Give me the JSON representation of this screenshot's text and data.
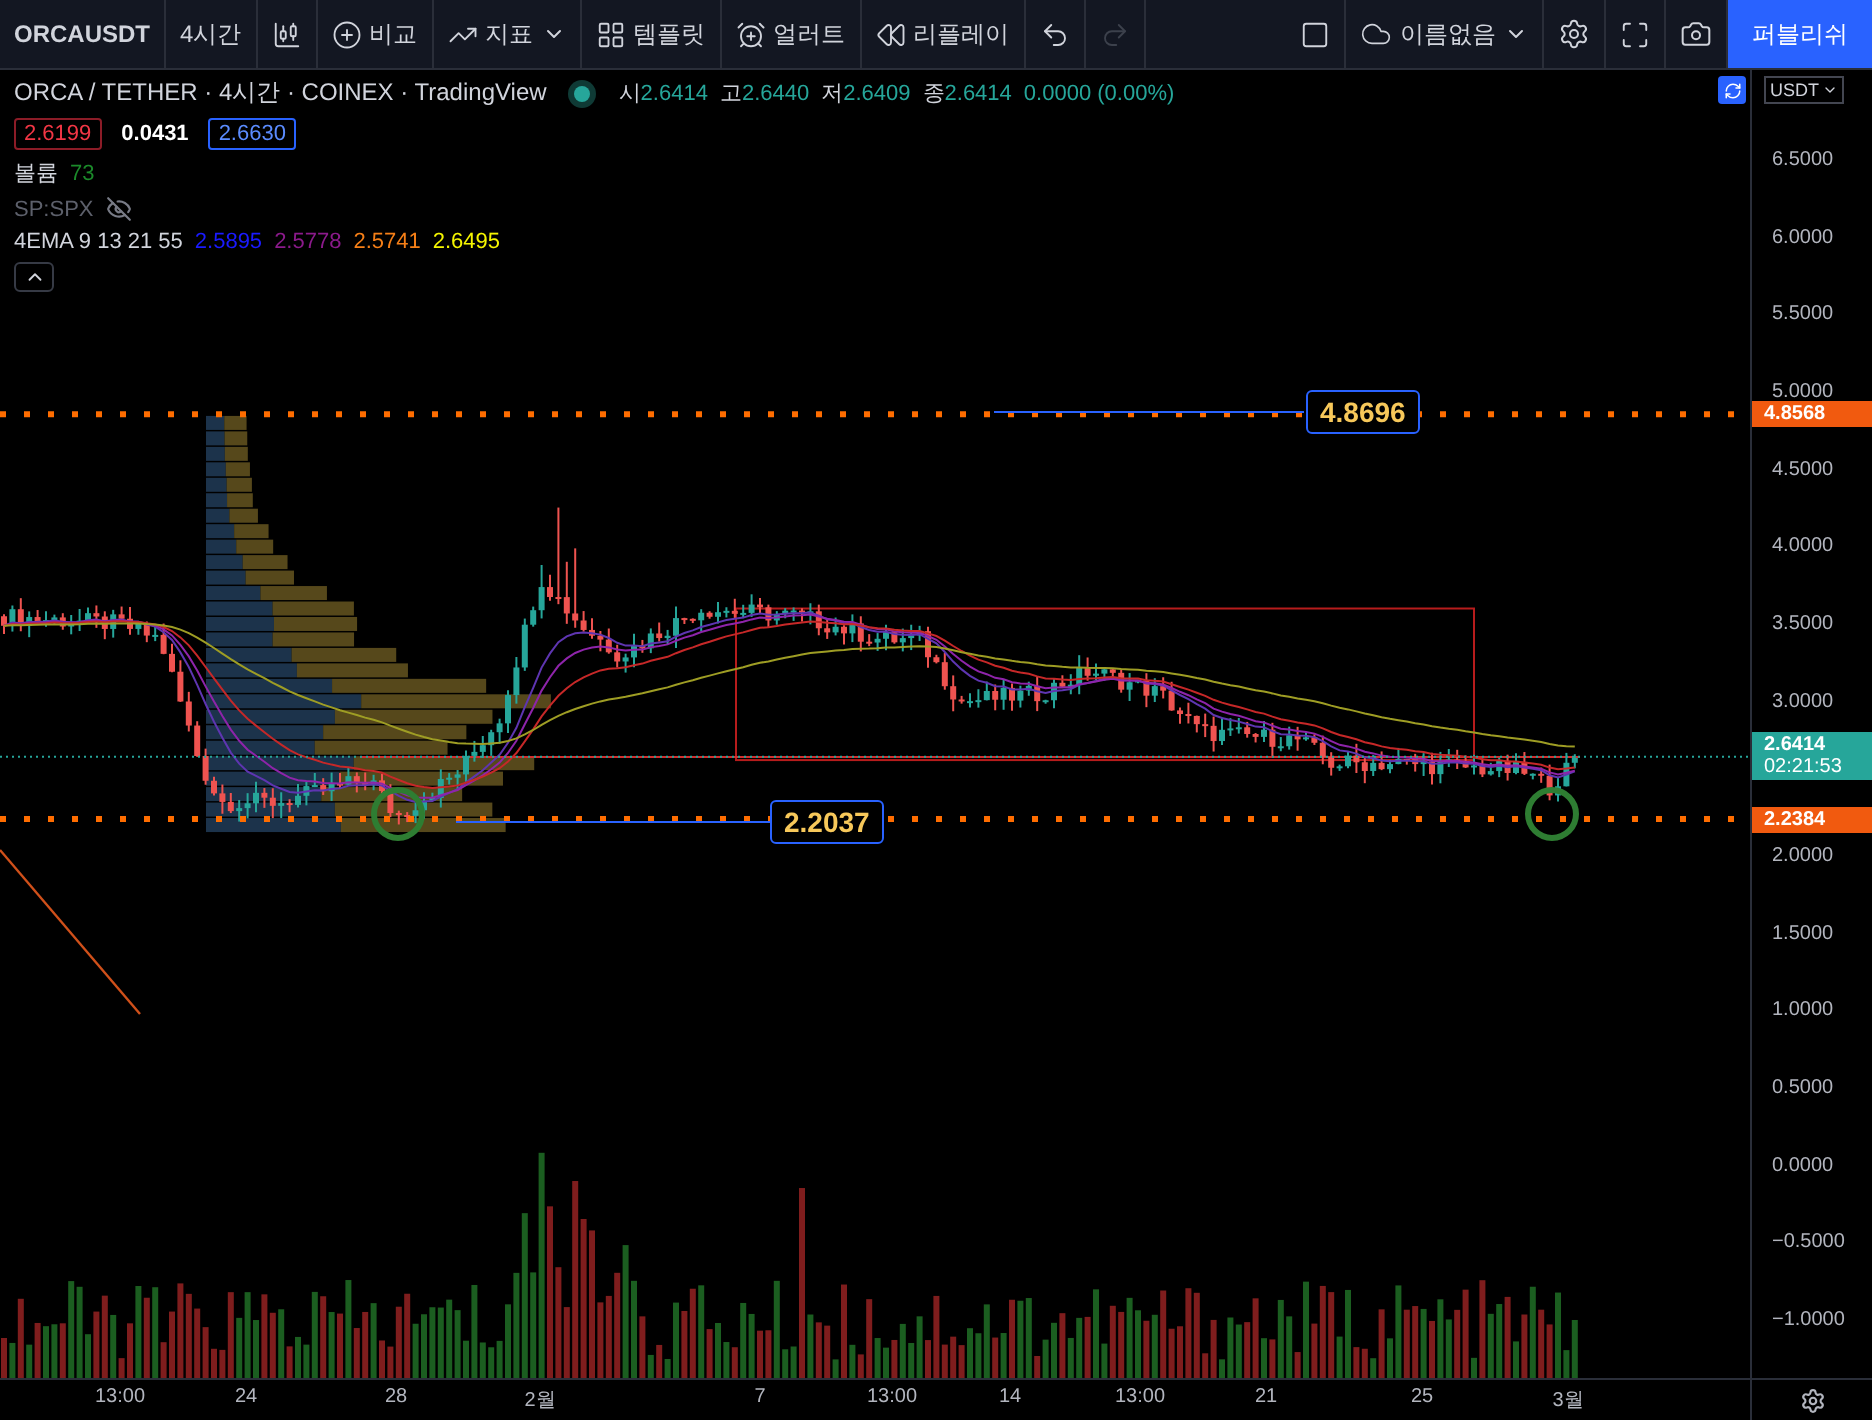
{
  "toolbar": {
    "symbol": "ORCAUSDT",
    "interval": "4시간",
    "items": [
      {
        "kind": "chart-type"
      },
      {
        "kind": "compare",
        "label": "비교"
      },
      {
        "kind": "indicators",
        "label": "지표"
      },
      {
        "kind": "templates",
        "label": "템플릿"
      },
      {
        "kind": "alert",
        "label": "얼러트"
      },
      {
        "kind": "replay",
        "label": "리플레이"
      },
      {
        "kind": "undo",
        "disabled": false
      },
      {
        "kind": "redo",
        "disabled": true
      }
    ],
    "layout_name": "이름없음",
    "publish": "퍼블리쉬"
  },
  "legend": {
    "title": "ORCA / TETHER · 4시간 · COINEX · TradingView",
    "ohlc": [
      {
        "label": "시",
        "value": "2.6414"
      },
      {
        "label": "고",
        "value": "2.6440"
      },
      {
        "label": "저",
        "value": "2.6409"
      },
      {
        "label": "종",
        "value": "2.6414"
      }
    ],
    "change": "0.0000 (0.00%)",
    "quotes": [
      {
        "kind": "bid",
        "value": "2.6199"
      },
      {
        "kind": "spread",
        "value": "0.0431"
      },
      {
        "kind": "ask",
        "value": "2.6630"
      }
    ],
    "volume": {
      "name": "볼륨",
      "value": "73"
    },
    "overlay": {
      "name": "SP:SPX",
      "hidden": true
    },
    "ema": {
      "name": "4EMA 9 13 21 55",
      "values": [
        {
          "value": "2.5895",
          "color": "#1a1aff"
        },
        {
          "value": "2.5778",
          "color": "#8b1a8b"
        },
        {
          "value": "2.5741",
          "color": "#f57f17"
        },
        {
          "value": "2.6495",
          "color": "#f5f500"
        }
      ]
    }
  },
  "annotations": [
    {
      "value": "4.8696"
    },
    {
      "value": "2.2037"
    }
  ],
  "price_axis": {
    "currency": "USDT",
    "ticks": [
      "6.5000",
      "6.0000",
      "5.5000",
      "5.0000",
      "4.5000",
      "4.0000",
      "3.5000",
      "3.0000",
      "2.0000",
      "1.5000",
      "1.0000",
      "0.5000",
      "0.0000",
      "−0.5000",
      "−1.0000"
    ],
    "markers": [
      {
        "kind": "line",
        "value": "4.8568"
      },
      {
        "kind": "last",
        "value": "2.6414",
        "countdown": "02:21:53"
      },
      {
        "kind": "line",
        "value": "2.2384"
      }
    ]
  },
  "time_axis": [
    "13:00",
    "24",
    "28",
    "2월",
    "7",
    "13:00",
    "14",
    "13:00",
    "21",
    "25",
    "3월"
  ]
}
